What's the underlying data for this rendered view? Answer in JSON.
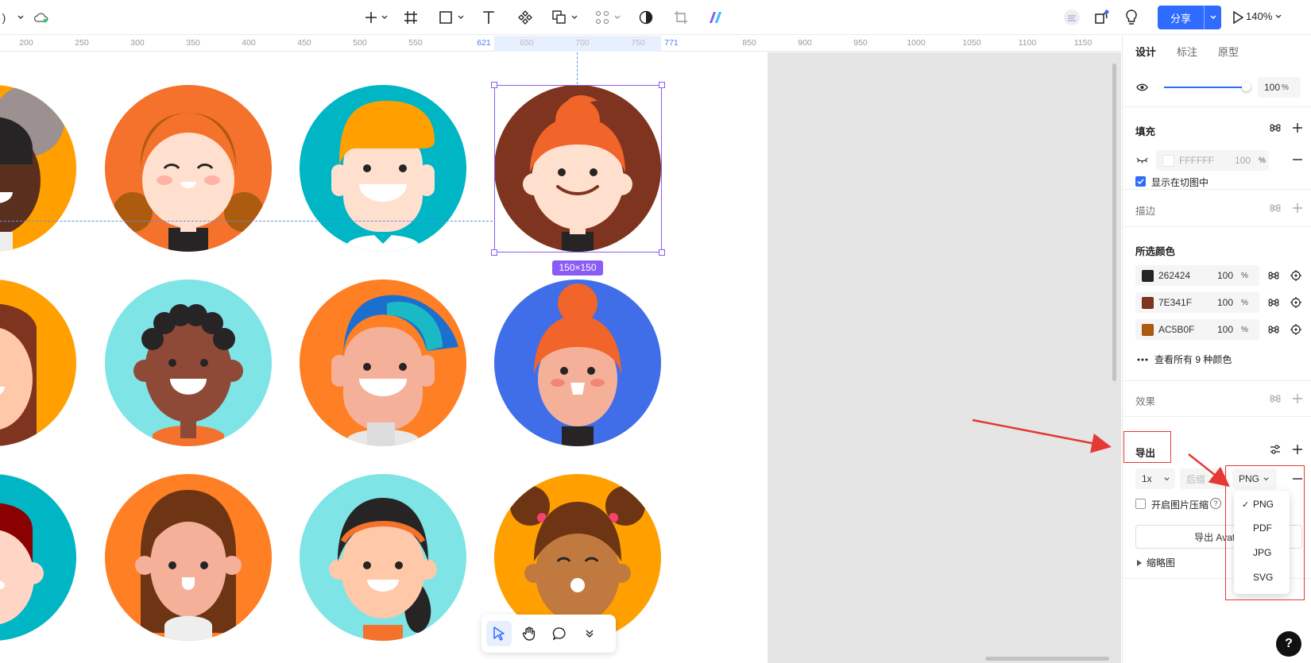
{
  "toolbar": {
    "share_label": "分享",
    "zoom": "140%"
  },
  "ruler": {
    "ticks": [
      "200",
      "250",
      "300",
      "350",
      "400",
      "450",
      "500",
      "550",
      "621",
      "650",
      "700",
      "750",
      "771",
      "850",
      "900",
      "950",
      "1000",
      "1050",
      "1100",
      "1150"
    ]
  },
  "canvas": {
    "selection_size": "150×150",
    "avatar_bg_colors": [
      "#ffa000",
      "#f4722b",
      "#00b6c5",
      "#7e341f",
      "#ffa000",
      "#7ee4e6",
      "#ff7f24",
      "#3f6ee8",
      "#00b6c5",
      "#ff7f24",
      "#7ee4e6",
      "#ffa000"
    ]
  },
  "panel": {
    "tabs": [
      "设计",
      "标注",
      "原型"
    ],
    "opacity": {
      "value": "100",
      "unit": "%"
    },
    "fill": {
      "title": "填充",
      "hex": "FFFFFF",
      "opacity": "100",
      "unit": "%",
      "show_in_slice": "显示在切图中"
    },
    "stroke": {
      "title": "描边"
    },
    "selected_colors": {
      "title": "所选颜色",
      "items": [
        {
          "hex": "262424",
          "opacity": "100",
          "unit": "%",
          "color": "#262424"
        },
        {
          "hex": "7E341F",
          "opacity": "100",
          "unit": "%",
          "color": "#7e341f"
        },
        {
          "hex": "AC5B0F",
          "opacity": "100",
          "unit": "%",
          "color": "#ac5b0f"
        }
      ],
      "view_all": "查看所有 9 种颜色"
    },
    "effects": {
      "title": "效果"
    },
    "export": {
      "title": "导出",
      "scale": "1x",
      "suffix_placeholder": "后缀",
      "format": "PNG",
      "compress_label": "开启图片压缩",
      "export_button": "导出 Avatar",
      "thumbnail": "缩略图",
      "format_options": [
        "PNG",
        "PDF",
        "JPG",
        "SVG"
      ]
    }
  },
  "bottom_toolbar": {
    "tools": [
      "move-tool",
      "hand-tool",
      "comment-tool",
      "more-tools"
    ]
  },
  "help": "?"
}
